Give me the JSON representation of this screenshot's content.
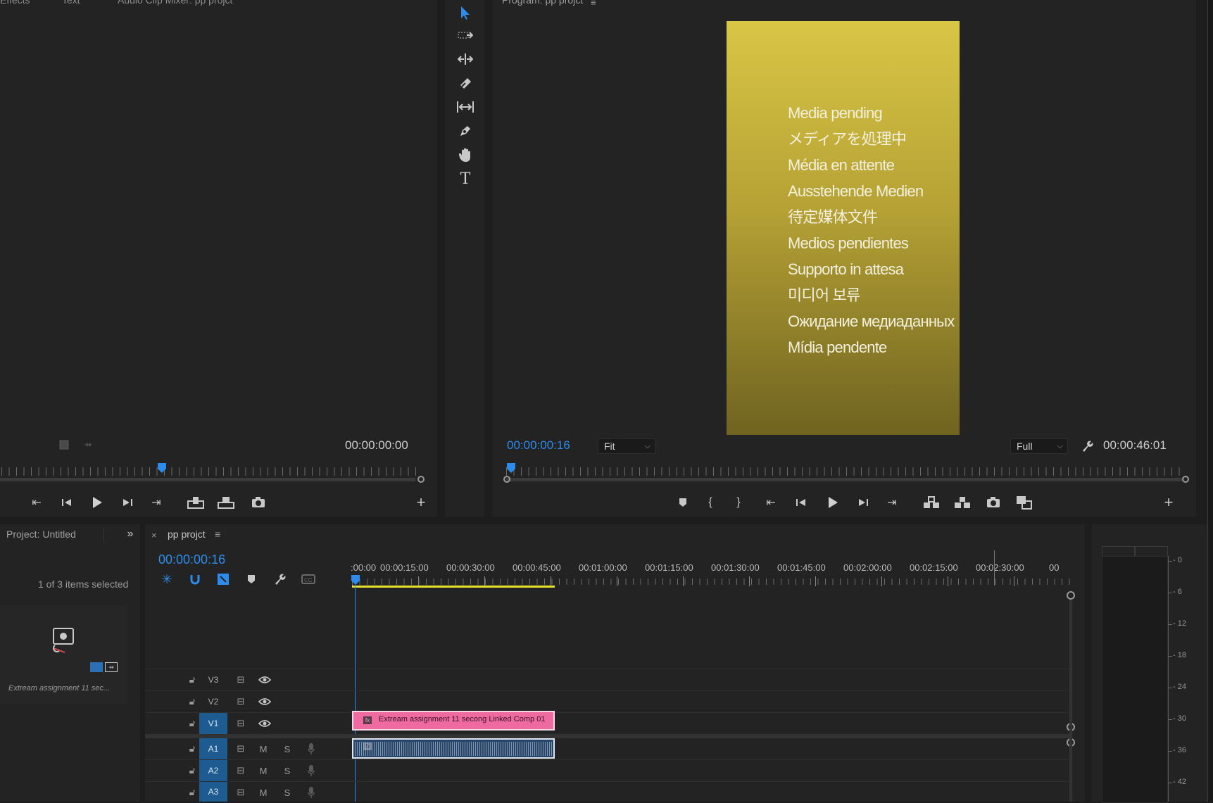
{
  "source_panel": {
    "tabs": [
      "Effects",
      "Text",
      "Audio Clip Mixer: pp projct"
    ],
    "timecode": "00:00:00:00"
  },
  "tools": [
    "selection-tool",
    "track-select-tool",
    "ripple-edit-tool",
    "razor-tool",
    "slip-tool",
    "pen-tool",
    "hand-tool",
    "type-tool"
  ],
  "program_monitor": {
    "title": "Program: pp projct",
    "timecode": "00:00:00:16",
    "zoom": "Fit",
    "resolution": "Full",
    "duration": "00:00:46:01",
    "media_pending_lines": [
      "Media pending",
      "メディアを処理中",
      "Média en attente",
      "Ausstehende Medien",
      "待定媒体文件",
      "Medios pendientes",
      "Supporto in attesa",
      "미디어 보류",
      "Ожидание медиаданных",
      "Mídia pendente"
    ],
    "playhead_fraction": 0.007
  },
  "project_panel": {
    "title": "Project: Untitled",
    "selection_status": "1 of 3 items selected",
    "item_name": "Extream assignment 11 sec..."
  },
  "timeline": {
    "sequence_name": "pp projct",
    "timecode": "00:00:00:16",
    "ruler_labels": [
      ":00:00",
      "00:00:15:00",
      "00:00:30:00",
      "00:00:45:00",
      "00:01:00:00",
      "00:01:15:00",
      "00:01:30:00",
      "00:01:45:00",
      "00:02:00:00",
      "00:02:15:00",
      "00:02:30:00",
      "00"
    ],
    "video_tracks": [
      {
        "label": "V3",
        "targeted": false
      },
      {
        "label": "V2",
        "targeted": false
      },
      {
        "label": "V1",
        "targeted": true
      }
    ],
    "audio_tracks": [
      {
        "label": "A1",
        "targeted": true,
        "mute": "M",
        "solo": "S"
      },
      {
        "label": "A2",
        "targeted": true,
        "mute": "M",
        "solo": "S"
      },
      {
        "label": "A3",
        "targeted": true,
        "mute": "M",
        "solo": "S"
      }
    ],
    "video_clip_name": "Extream assignment 11 secong Linked Comp 01"
  },
  "audio_meter": {
    "scale": [
      "0",
      "-6",
      "-12",
      "-18",
      "-24",
      "-30",
      "-36",
      "-42"
    ]
  },
  "colors": {
    "accent_blue": "#2d8ceb",
    "clip_pink": "#ef6aa1",
    "slate_top": "#d9c645",
    "slate_bottom": "#6f6320",
    "work_area": "#e8e02a"
  }
}
